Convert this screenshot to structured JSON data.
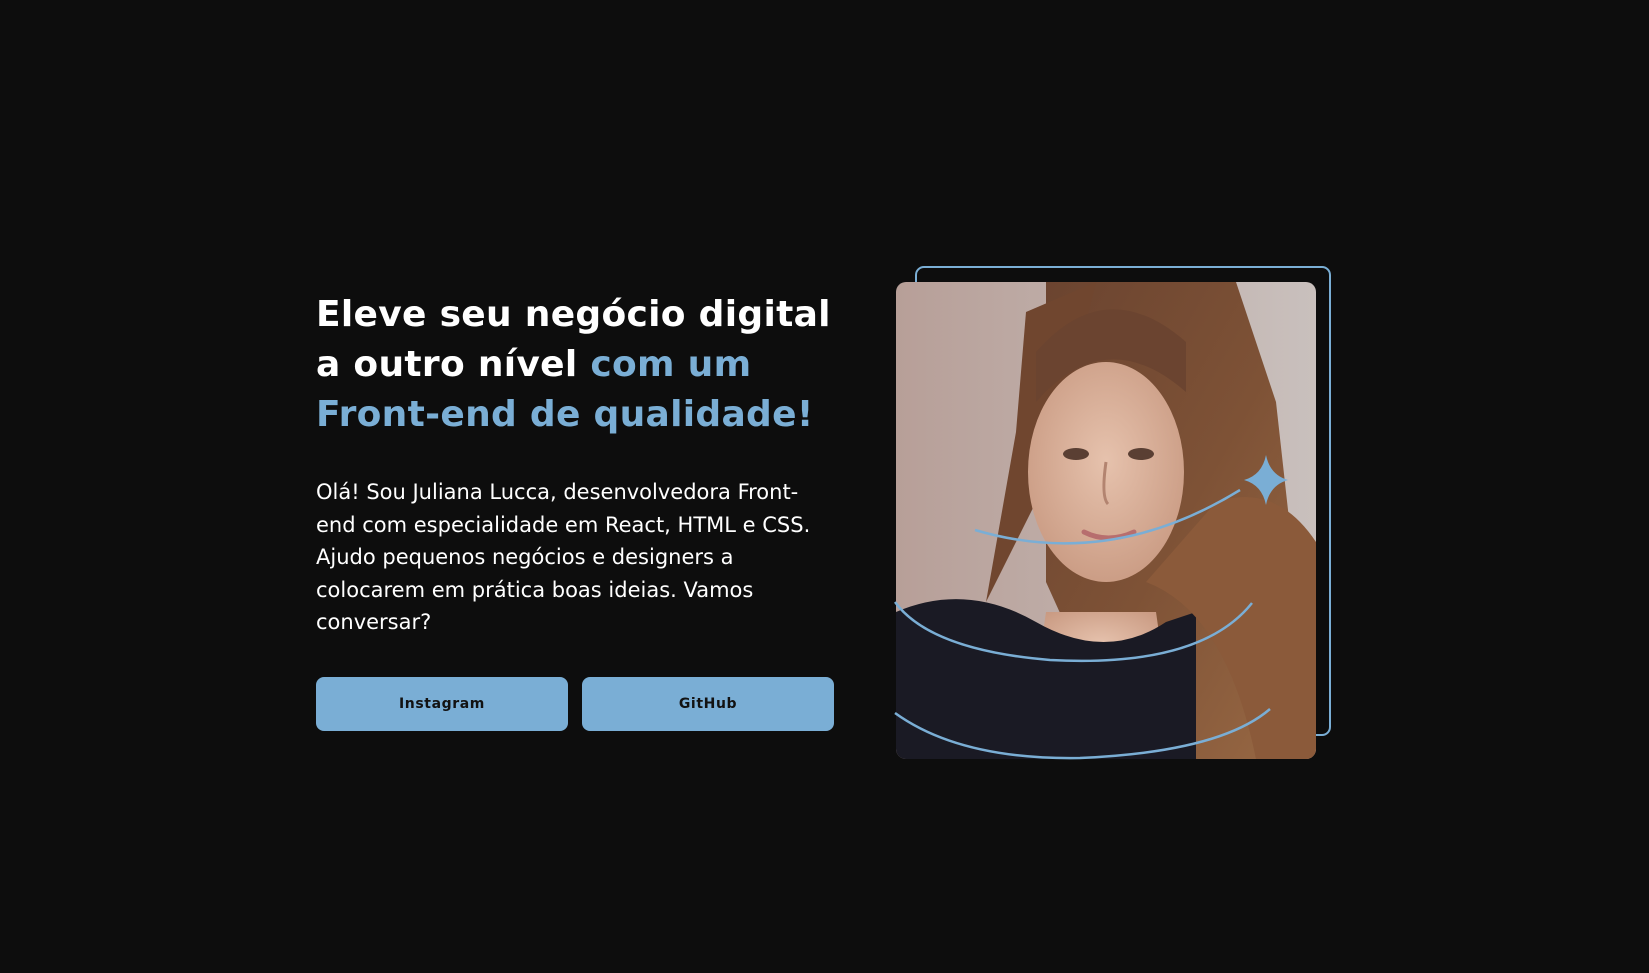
{
  "hero": {
    "headline_part1": "Eleve seu negócio digital a outro nível",
    "headline_accent": "com um Front-end de qualidade!",
    "intro": "Olá! Sou Juliana Lucca, desenvolvedora Front-end com especialidade em React, HTML e CSS. Ajudo pequenos negócios e designers a colocarem em prática boas ideias. Vamos conversar?"
  },
  "buttons": {
    "instagram_label": "Instagram",
    "github_label": "GitHub"
  },
  "colors": {
    "background": "#0d0d0d",
    "accent": "#7aaed5",
    "text": "#ffffff",
    "button_text": "#121212"
  },
  "icons": {
    "sparkle": "four-point-star-icon"
  }
}
